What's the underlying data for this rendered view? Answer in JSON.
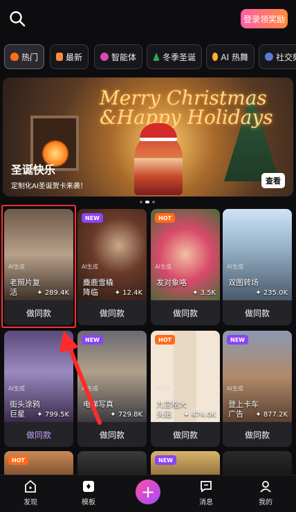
{
  "header": {
    "login_label": "登录领奖励"
  },
  "tabs": [
    {
      "label": "热门",
      "icon": "fire-icon",
      "color": "#ff6b1a"
    },
    {
      "label": "最新",
      "icon": "calendar-icon",
      "color": "#ff8a3d"
    },
    {
      "label": "智能体",
      "icon": "robot-icon",
      "color": "#d64bb0"
    },
    {
      "label": "冬季圣诞",
      "icon": "xmas-tree-icon",
      "color": "#2fa84f"
    },
    {
      "label": "AI 热舞",
      "icon": "dance-icon",
      "color": "#ffb02e"
    },
    {
      "label": "社交频",
      "icon": "social-icon",
      "color": "#5a7bd6"
    }
  ],
  "banner": {
    "overlay_line1": "Merry Christmas",
    "overlay_line2": "&Happy Holidays",
    "title": "圣诞快乐",
    "subtitle": "定制化AI圣诞贺卡来袭！",
    "button": "查看"
  },
  "cards": [
    {
      "badge": "",
      "ai_tag": "AI生成",
      "title": "老照片复活",
      "likes": "289.4K",
      "button": "做同款",
      "alt": false
    },
    {
      "badge": "NEW",
      "ai_tag": "AI生成",
      "title": "麋鹿雪橇降临",
      "likes": "12.4K",
      "button": "做同款",
      "alt": false
    },
    {
      "badge": "HOT",
      "ai_tag": "AI生成",
      "title": "发对象咯",
      "likes": "3.5K",
      "button": "做同款",
      "alt": false
    },
    {
      "badge": "",
      "ai_tag": "AI生成",
      "title": "双图转场",
      "likes": "235.0K",
      "button": "做同款",
      "alt": false
    },
    {
      "badge": "",
      "ai_tag": "AI生成",
      "title": "街头涂鸦巨星",
      "likes": "799.5K",
      "button": "做同款",
      "alt": true
    },
    {
      "badge": "NEW",
      "ai_tag": "AI生成",
      "title": "电梯写真",
      "likes": "729.8K",
      "button": "做同款",
      "alt": false
    },
    {
      "badge": "HOT",
      "ai_tag": "AI生成",
      "title": "九宫格大头贴",
      "likes": "474.0K",
      "button": "做同款",
      "alt": false
    },
    {
      "badge": "NEW",
      "ai_tag": "AI生成",
      "title": "登上卡车广告",
      "likes": "877.2K",
      "button": "做同款",
      "alt": false
    },
    {
      "badge": "HOT",
      "ai_tag": "",
      "title": "",
      "likes": "",
      "button": "",
      "alt": false
    },
    {
      "badge": "",
      "ai_tag": "",
      "title": "",
      "likes": "",
      "button": "",
      "alt": false
    },
    {
      "badge": "NEW",
      "ai_tag": "",
      "title": "",
      "likes": "",
      "button": "",
      "alt": false
    },
    {
      "badge": "",
      "ai_tag": "",
      "title": "",
      "likes": "",
      "button": "",
      "alt": false
    }
  ],
  "nav": [
    {
      "label": "发现",
      "icon": "discover-icon"
    },
    {
      "label": "模板",
      "icon": "template-icon"
    },
    {
      "label": "消息",
      "icon": "message-icon"
    },
    {
      "label": "我的",
      "icon": "profile-icon"
    }
  ]
}
